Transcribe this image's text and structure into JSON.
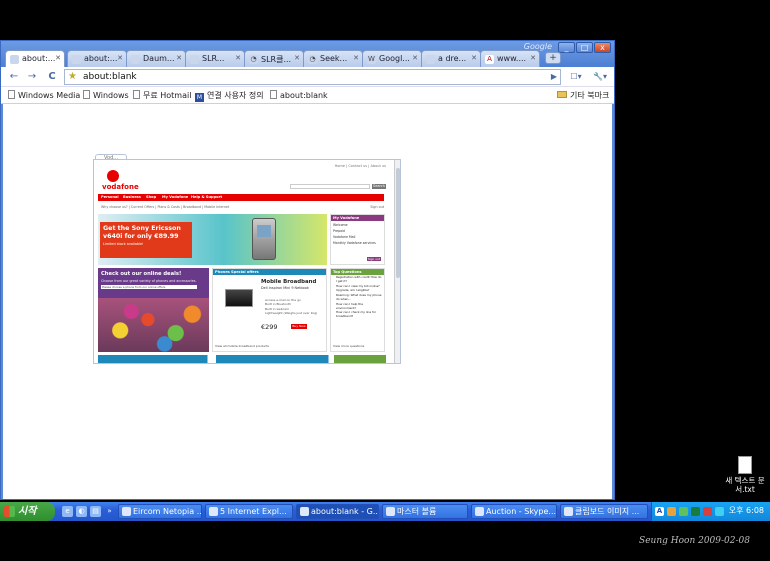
{
  "browser": {
    "brand": "Google",
    "window_buttons": {
      "minimize": "_",
      "restore": "□",
      "close": "x"
    },
    "tabs": [
      {
        "label": "about:...",
        "icon": "blank-page-icon",
        "active": true
      },
      {
        "label": "about:...",
        "icon": "blank-page-icon",
        "active": false
      },
      {
        "label": "Daum...",
        "icon": "page-icon",
        "active": false
      },
      {
        "label": "SLR...",
        "icon": "page-icon",
        "active": false
      },
      {
        "label": "SLR클...",
        "icon": "loading-icon",
        "active": false
      },
      {
        "label": "Seek...",
        "icon": "loading-icon",
        "active": false
      },
      {
        "label": "Googl...",
        "icon": "wikipedia-icon",
        "active": false
      },
      {
        "label": "a dre...",
        "icon": "page-icon",
        "active": false
      },
      {
        "label": "www....",
        "icon": "adobe-icon",
        "active": false
      }
    ],
    "toolbar": {
      "back": "←",
      "forward": "→",
      "reload": "C",
      "address": "about:blank",
      "go": "▶",
      "page_menu": "☐▾",
      "tools_menu": "🔧▾"
    },
    "bookmarks": [
      {
        "label": "Windows Media",
        "icon": "page-icon"
      },
      {
        "label": "Windows",
        "icon": "page-icon"
      },
      {
        "label": "무료 Hotmail",
        "icon": "page-icon"
      },
      {
        "label": "연결 사용자 정의",
        "icon": "live-icon"
      },
      {
        "label": "about:blank",
        "icon": "page-icon"
      }
    ],
    "other_bookmarks": "기타 북마크"
  },
  "thumbnail": {
    "tab_label": "Vod...",
    "top_links": "Home | Contact us | About us",
    "logo": "vodafone",
    "search_button": "Search",
    "nav": [
      "Personal",
      "Business",
      "Shop",
      "My Vodafone",
      "Help & Support"
    ],
    "breadcrumb": "Why choose us? | Current Offers | Plans & Costs | Broadband | Mobile Internet",
    "sign_in": "Sign out",
    "promo_title": "Get the Sony Ericsson v640i for only €89.99",
    "promo_sub": "Limited stock available!",
    "my_vodafone": {
      "title": "My Vodafone",
      "lines": [
        "Welcome",
        "Prepaid",
        "Vodafone Mail",
        "Monthly Vodafone services"
      ],
      "button": "Sign out"
    },
    "deals": {
      "title": "Check out our online deals!",
      "text": "Choose from our great variety of phones and accessories.",
      "select": "Please choose a phone from our online offers"
    },
    "offer": {
      "header": "Phones Special offers",
      "title": "Mobile Broadband",
      "subtitle": "Dell Inspiron Mini 9 Netbook",
      "features": [
        "Access e-mail on the go",
        "Built in Bluetooth",
        "Built in webcam",
        "Lightweight (Weighs just over 1kg)"
      ],
      "price": "€299",
      "buy": "Buy Now",
      "view": "View all mobile broadband products"
    },
    "top_questions": {
      "title": "Top Questions",
      "items": [
        "Registration with credit How do I get it?",
        "How can I view my bill online?",
        "Upgrade, am I eligible?",
        "Roaming: What does my phone do when...",
        "How can I help the environment?",
        "How can I check my line for broadband?"
      ],
      "view": "View more questions"
    }
  },
  "desktop": {
    "icon_label": "새 텍스트 문서.txt"
  },
  "taskbar": {
    "start": "시작",
    "quick_launch": [
      "e",
      "◐",
      "▤",
      "»"
    ],
    "tasks": [
      {
        "label": "Eircom Netopia ...",
        "active": false
      },
      {
        "label": "5 Internet Expl...",
        "active": false
      },
      {
        "label": "about:blank - G...",
        "active": true
      },
      {
        "label": "마스터 볼륨",
        "active": false
      },
      {
        "label": "Auction - Skype...",
        "active": false
      },
      {
        "label": "클립보드 이미지 ...",
        "active": false
      }
    ],
    "tray_text": "A",
    "clock": "오후 6:08"
  },
  "signature": "Seung Hoon 2009-02-08"
}
